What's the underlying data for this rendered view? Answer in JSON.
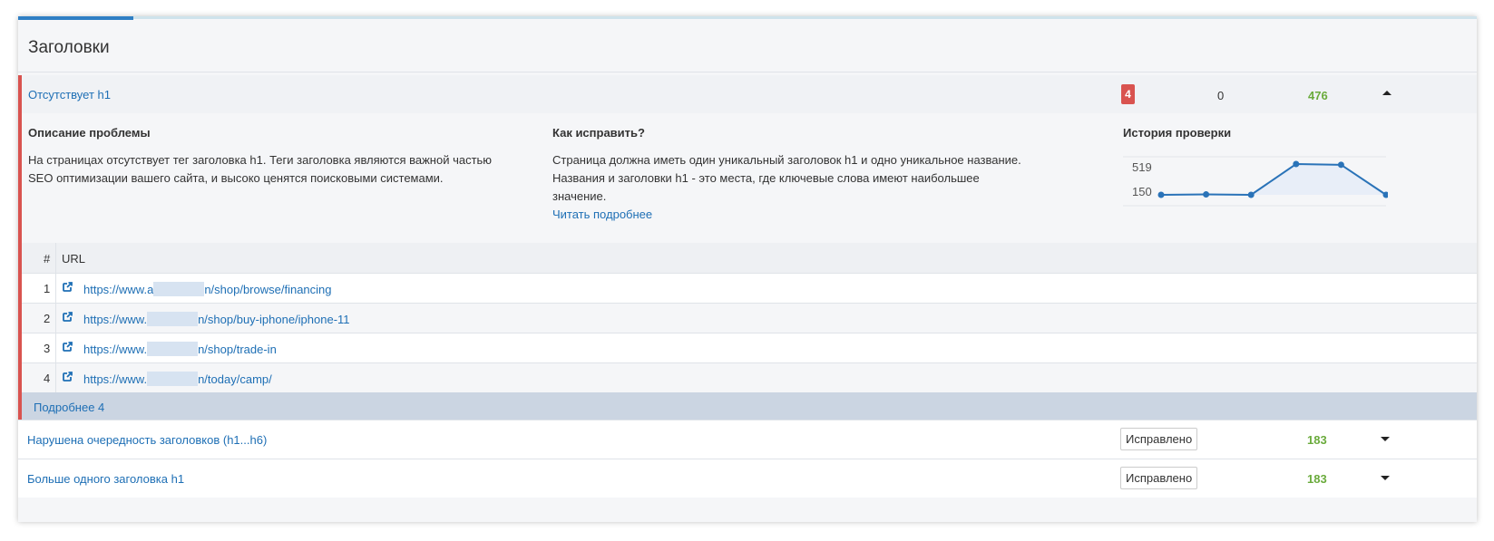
{
  "panel": {
    "title": "Заголовки"
  },
  "issue_main": {
    "title": "Отсутствует h1",
    "errors": "4",
    "warnings": "0",
    "passed": "476",
    "description_heading": "Описание проблемы",
    "description_lines": [
      "На страницах отсутствует тег заголовка h1. Теги заголовка являются важной частью",
      "SEO оптимизации вашего сайта, и высоко ценятся поисковыми системами."
    ],
    "fix_heading": "Как исправить?",
    "fix_lines": [
      "Страница должна иметь один уникальный заголовок h1 и одно уникальное название.",
      "Названия и заголовки h1 - это места, где ключевые слова имеют наибольшее",
      "значение."
    ],
    "read_more": "Читать подробнее",
    "history_heading": "История проверки"
  },
  "chart_data": {
    "type": "line",
    "title": "История проверки",
    "ytick_labels": [
      "519",
      "150"
    ],
    "values": [
      150,
      155,
      150,
      519,
      510,
      150
    ],
    "color": "#2a73b8"
  },
  "table": {
    "col_hash": "#",
    "col_url": "URL",
    "rows": [
      {
        "num": "1",
        "url_prefix": "https://www.a",
        "url_suffix": "n/shop/browse/financing"
      },
      {
        "num": "2",
        "url_prefix": "https://www.",
        "url_suffix": "n/shop/buy-iphone/iphone-11"
      },
      {
        "num": "3",
        "url_prefix": "https://www.",
        "url_suffix": "n/shop/trade-in"
      },
      {
        "num": "4",
        "url_prefix": "https://www.",
        "url_suffix": "n/today/camp/"
      }
    ]
  },
  "more_label": "Подробнее 4",
  "issues": [
    {
      "title": "Нарушена очередность заголовков (h1...h6)",
      "button": "Исправлено",
      "passed": "183"
    },
    {
      "title": "Больше одного заголовка h1",
      "button": "Исправлено",
      "passed": "183"
    }
  ],
  "colors": {
    "accent": "#2f7fc4",
    "error": "#d9534f",
    "success": "#6aab3c",
    "link": "#1e6fb5"
  }
}
